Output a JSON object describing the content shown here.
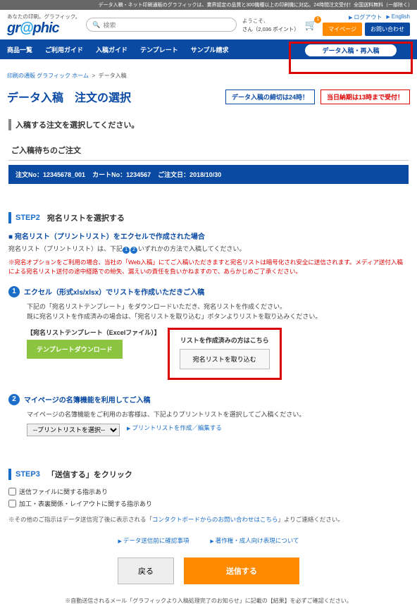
{
  "top_note": "データ入稿・ネット印刷通販のグラフィックは、業界認定の品質と300機種以上の印刷機に対応。24時間注文受付！全国送料無料（一部除く）",
  "tagline": "あなたの印刷。グラフィック。",
  "logo_a": "gr",
  "logo_b": "@",
  "logo_c": "phic",
  "search_placeholder": "検索",
  "welcome": "ようこそ、",
  "points": "さん（2,036 ポイント）",
  "cart_count": "1",
  "logout": "ログアウト",
  "english": "English",
  "btn_mypage": "マイページ",
  "btn_contact": "お問い合わせ",
  "nav": [
    "商品一覧",
    "ご利用ガイド",
    "入稿ガイド",
    "テンプレート",
    "サンプル請求"
  ],
  "nav_pill": "データ入稿・再入稿",
  "breadcrumb_link": "印刷の通販 グラフィック ホーム",
  "breadcrumb_current": "データ入稿",
  "page_title": "データ入稿　注文の選択",
  "deadline1": "データ入稿の締切は24時！",
  "deadline2": "当日納期は13時まで受付！",
  "gray_title": "入稿する注文を選択してください。",
  "pending_title": "ご入稿待ちのご注文",
  "order_no_label": "注文No：",
  "order_no": "12345678_001",
  "cart_no_label": "カートNo：",
  "cart_no": "1234567",
  "order_date_label": "ご注文日：",
  "order_date": "2018/10/30",
  "step2": "STEP2",
  "step2_title": "宛名リストを選択する",
  "step2_sub": "宛名リスト（プリントリスト）をエクセルで作成された場合",
  "step2_body": "宛名リスト（プリントリスト）は、下記①②いずれかの方法で入稿してください。",
  "step2_red": "※宛名オプションをご利用の場合、当社の「Web入稿」にてご入稿いただきますと宛名リストは暗号化され安全に送信されます。メディア送付入稿による宛名リスト送付の途中経路での紛失、漏えいの責任を負いかねますので、あらかじめご了承ください。",
  "excel_title": "エクセル（形式xls/xlsx）でリストを作成いただきご入稿",
  "excel_body": "下記の「宛名リストテンプレート」をダウンロードいただき、宛名リストを作成ください。\n既に宛名リストを作成済みの場合は、「宛名リストを取り込む」ボタンよりリストを取り込みください。",
  "tmpl_label": "【宛名リストテンプレート（Excelファイル）】",
  "btn_template": "テンプレートダウンロード",
  "redbox_title": "リストを作成済みの方はこちら",
  "btn_import": "宛名リストを取り込む",
  "mypage_title": "マイページの名簿機能を利用してご入稿",
  "mypage_body": "マイページの名簿機能をご利用のお客様は、下記よりプリントリストを選択してご入稿ください。",
  "select_default": "--プリントリストを選択--",
  "link_edit": "プリントリストを作成／編集する",
  "step3": "STEP3",
  "step3_title": "「送信する」をクリック",
  "cb1": "送信ファイルに関する指示あり",
  "cb2": "加工・表裏関係・レイアウトに関する指示あり",
  "note_prefix": "※その他のご指示はデータ送信完了後に表示される「",
  "note_link": "コンタクトボードからのお問い合わせはこちら",
  "note_suffix": "」よりご連絡ください。",
  "link1": "データ送信前に確認事項",
  "link2": "著作権・成人向け表現について",
  "btn_back": "戻る",
  "btn_send": "送信する",
  "footer": "※自動送信されるメール「グラフィックより入稿処理完了のお知らせ」に記載の【結果】を必ずご確認ください。"
}
